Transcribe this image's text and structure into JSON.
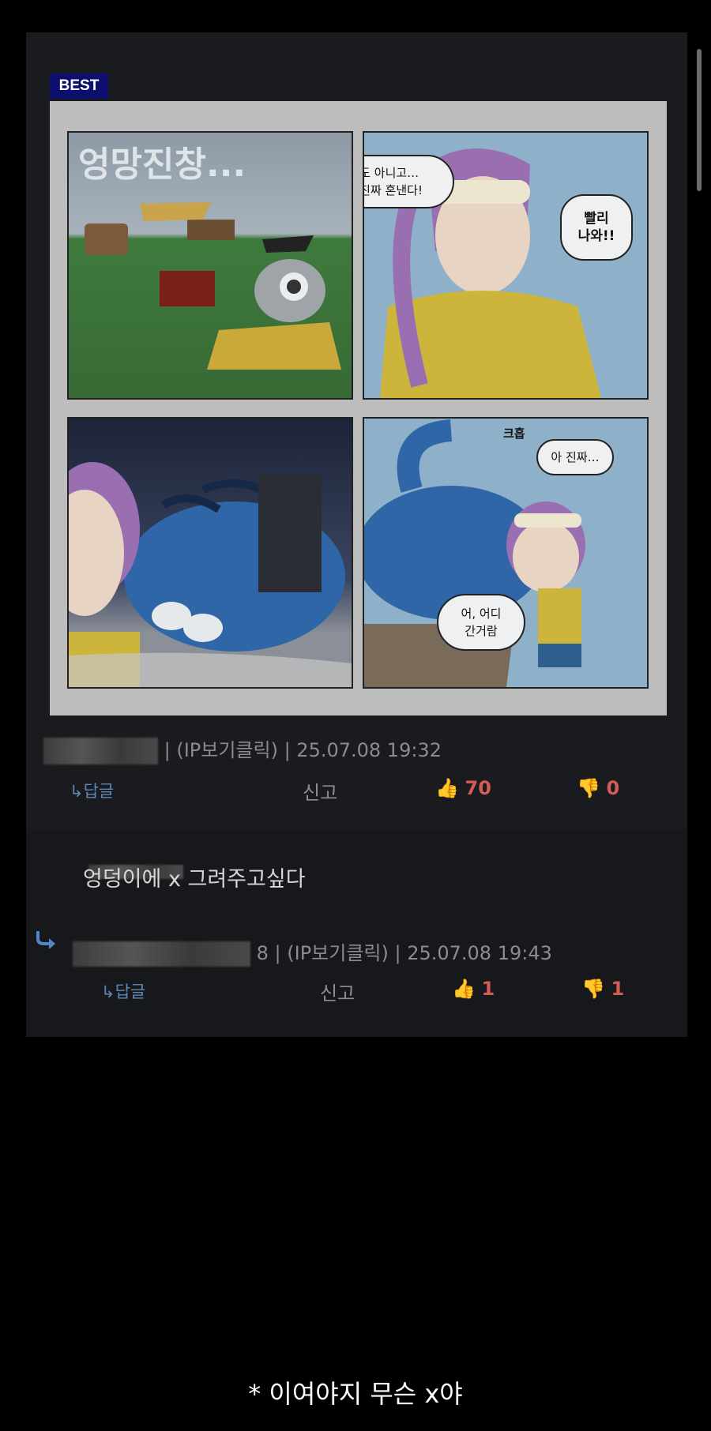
{
  "badge": "BEST",
  "comic": {
    "sfx": "엉망진창...",
    "bubble1": "한두번도 아니고…\n이번엔 진짜 혼낸다!",
    "bubble2": "빨리\n나와!!",
    "sound": "크흡",
    "bubble3": "아 진짜…",
    "bubble4": "어, 어디\n간거람"
  },
  "comment1": {
    "meta": "| (IP보기클릭) | 25.07.08 19:32",
    "reply_label": "↳답글",
    "report_label": "신고",
    "likes": "70",
    "dislikes": "0"
  },
  "comment2": {
    "text": "엉덩이에 x 그려주고싶다",
    "meta": "8 | (IP보기클릭) | 25.07.08 19:43",
    "reply_label": "↳답글",
    "report_label": "신고",
    "likes": "1",
    "dislikes": "1"
  },
  "caption": "* 이여야지 무슨 x야",
  "colors": {
    "accent_blue": "#4f78ad",
    "count_red": "#d55b57",
    "badge_bg": "#0c0f6e"
  }
}
